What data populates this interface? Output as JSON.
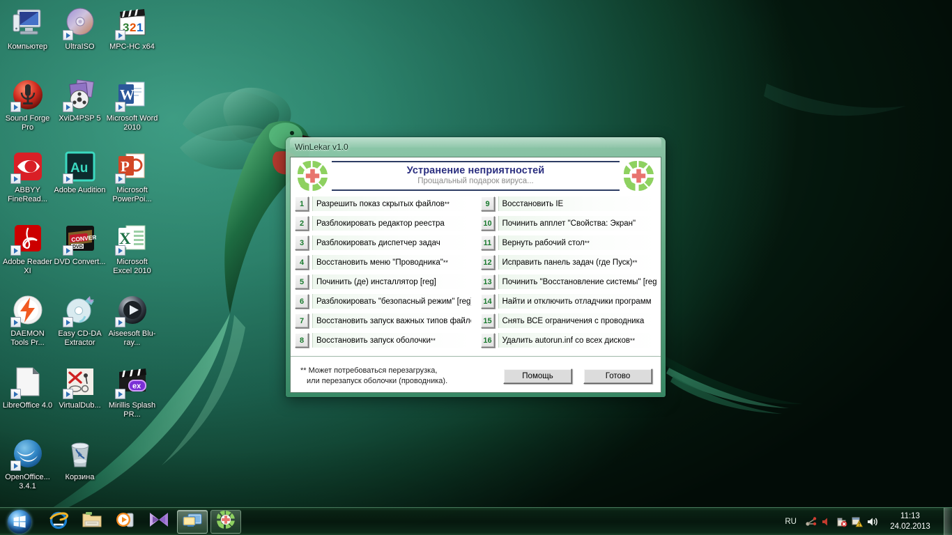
{
  "desktop": {
    "icons": [
      {
        "label": "Компьютер",
        "icon": "computer-icon"
      },
      {
        "label": "UltraISO",
        "icon": "disc-icon"
      },
      {
        "label": "MPC-HC x64",
        "icon": "clapperboard-321-icon"
      },
      {
        "label": "Sound Forge Pro",
        "icon": "microphone-icon"
      },
      {
        "label": "XviD4PSP 5",
        "icon": "film-reel-icon"
      },
      {
        "label": "Microsoft Word 2010",
        "icon": "word-icon"
      },
      {
        "label": "ABBYY FineRead...",
        "icon": "abbyy-eye-icon"
      },
      {
        "label": "Adobe Audition",
        "icon": "audition-icon"
      },
      {
        "label": "Microsoft PowerPoi...",
        "icon": "powerpoint-icon"
      },
      {
        "label": "Adobe Reader XI",
        "icon": "acrobat-icon"
      },
      {
        "label": "DVD Convert...",
        "icon": "dvd-converter-icon"
      },
      {
        "label": "Microsoft Excel 2010",
        "icon": "excel-icon"
      },
      {
        "label": "DAEMON Tools Pr...",
        "icon": "daemon-tools-icon"
      },
      {
        "label": "Easy CD-DA Extractor",
        "icon": "cd-extractor-icon"
      },
      {
        "label": "Aiseesoft Blu-ray...",
        "icon": "bluray-play-icon"
      },
      {
        "label": "LibreOffice 4.0",
        "icon": "libreoffice-doc-icon"
      },
      {
        "label": "VirtualDub...",
        "icon": "virtualdub-icon"
      },
      {
        "label": "Mirillis Splash PR...",
        "icon": "mirillis-ex-icon"
      },
      {
        "label": "OpenOffice... 3.4.1",
        "icon": "openoffice-gulls-icon"
      },
      {
        "label": "Корзина",
        "icon": "recycle-bin-icon"
      }
    ]
  },
  "window": {
    "title": "WinLekar v1.0",
    "header": {
      "title": "Устранение неприятностей",
      "subtitle": "Прощальный подарок вируса...",
      "logo": "green-medical-cross-icon"
    },
    "left_column": [
      {
        "num": "1",
        "label": "Разрешить показ скрытых файлов",
        "mark": "**"
      },
      {
        "num": "2",
        "label": "Разблокировать редактор реестра",
        "mark": ""
      },
      {
        "num": "3",
        "label": "Разблокировать диспетчер задач",
        "mark": ""
      },
      {
        "num": "4",
        "label": "Восстановить меню \"Проводника\"",
        "mark": "**"
      },
      {
        "num": "5",
        "label": "Починить (де) инсталлятор [reg]",
        "mark": ""
      },
      {
        "num": "6",
        "label": "Разблокировать \"безопасный режим\" [reg]",
        "mark": ""
      },
      {
        "num": "7",
        "label": "Восстановить запуск важных типов файлов",
        "mark": ""
      },
      {
        "num": "8",
        "label": "Восстановить запуск оболочки",
        "mark": "**"
      }
    ],
    "right_column": [
      {
        "num": "9",
        "label": "Восстановить IE",
        "mark": ""
      },
      {
        "num": "10",
        "label": "Починить апплет \"Свойства: Экран\"",
        "mark": ""
      },
      {
        "num": "11",
        "label": "Вернуть рабочий стол",
        "mark": "**"
      },
      {
        "num": "12",
        "label": "Исправить панель задач (где Пуск)",
        "mark": "**"
      },
      {
        "num": "13",
        "label": "Починить \"Восстановление системы\" [reg]",
        "mark": "**"
      },
      {
        "num": "14",
        "label": "Найти и отключить отладчики программ",
        "mark": ""
      },
      {
        "num": "15",
        "label": "Снять ВСЕ ограничения с проводника",
        "mark": ""
      },
      {
        "num": "16",
        "label": "Удалить autorun.inf со всех дисков",
        "mark": "**"
      }
    ],
    "footer": {
      "note_line1": "** Может потребоваться перезагрузка,",
      "note_line2": "или перезапуск оболочки (проводника).",
      "help_button": "Помощь",
      "done_button": "Готово"
    }
  },
  "taskbar": {
    "start": "start-orb-icon",
    "buttons": [
      {
        "icon": "internet-explorer-icon",
        "active": false
      },
      {
        "icon": "explorer-folder-icon",
        "active": false
      },
      {
        "icon": "media-player-icon",
        "active": false
      },
      {
        "icon": "butterfly-icon",
        "active": false
      },
      {
        "icon": "display-properties-icon",
        "active": true
      },
      {
        "icon": "winlekar-icon",
        "active": true
      }
    ],
    "tray": {
      "language": "RU",
      "icons": [
        "network-icon",
        "volume-mute-icon",
        "action-center-error-icon",
        "flag-warning-icon",
        "speaker-icon"
      ],
      "time": "11:13",
      "date": "24.02.2013"
    }
  },
  "colors": {
    "desktop_green": "#2e9178",
    "title_blue": "#2b2f80",
    "number_green": "#1a7a2e",
    "cross_red": "#e8746f",
    "logo_green": "#8ed160"
  }
}
